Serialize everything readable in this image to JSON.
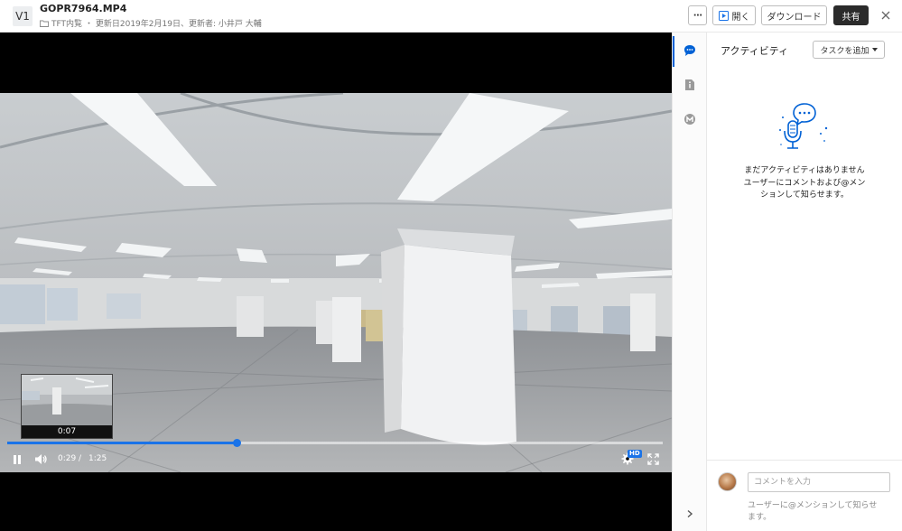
{
  "header": {
    "version_badge": "V1",
    "file_name": "GOPR7964.MP4",
    "folder": "TFT内覧",
    "meta": "・ 更新日2019年2月19日、更新者: 小井戸 大輔",
    "more_label": "⋯",
    "open_label": "開く",
    "download_label": "ダウンロード",
    "share_label": "共有"
  },
  "player": {
    "thumbnail_time": "0:07",
    "current_time": "0:29",
    "separator": "/",
    "total_time": "1:25",
    "progress": 0.35,
    "quality_badge": "HD",
    "accent_color": "#1a73e8"
  },
  "rail": {
    "items": [
      {
        "icon": "activity-icon",
        "active": true
      },
      {
        "icon": "info-icon",
        "active": false
      },
      {
        "icon": "skills-icon",
        "active": false
      }
    ],
    "collapse_icon": "chevron-right-icon"
  },
  "activity": {
    "title": "アクティビティ",
    "add_task_label": "タスクを追加",
    "empty_title": "まだアクティビティはありません",
    "empty_description": "ユーザーにコメントおよび@メンションして知らせます。",
    "comment_placeholder": "コメントを入力",
    "comment_hint": "ユーザーに@メンションして知らせます。"
  }
}
